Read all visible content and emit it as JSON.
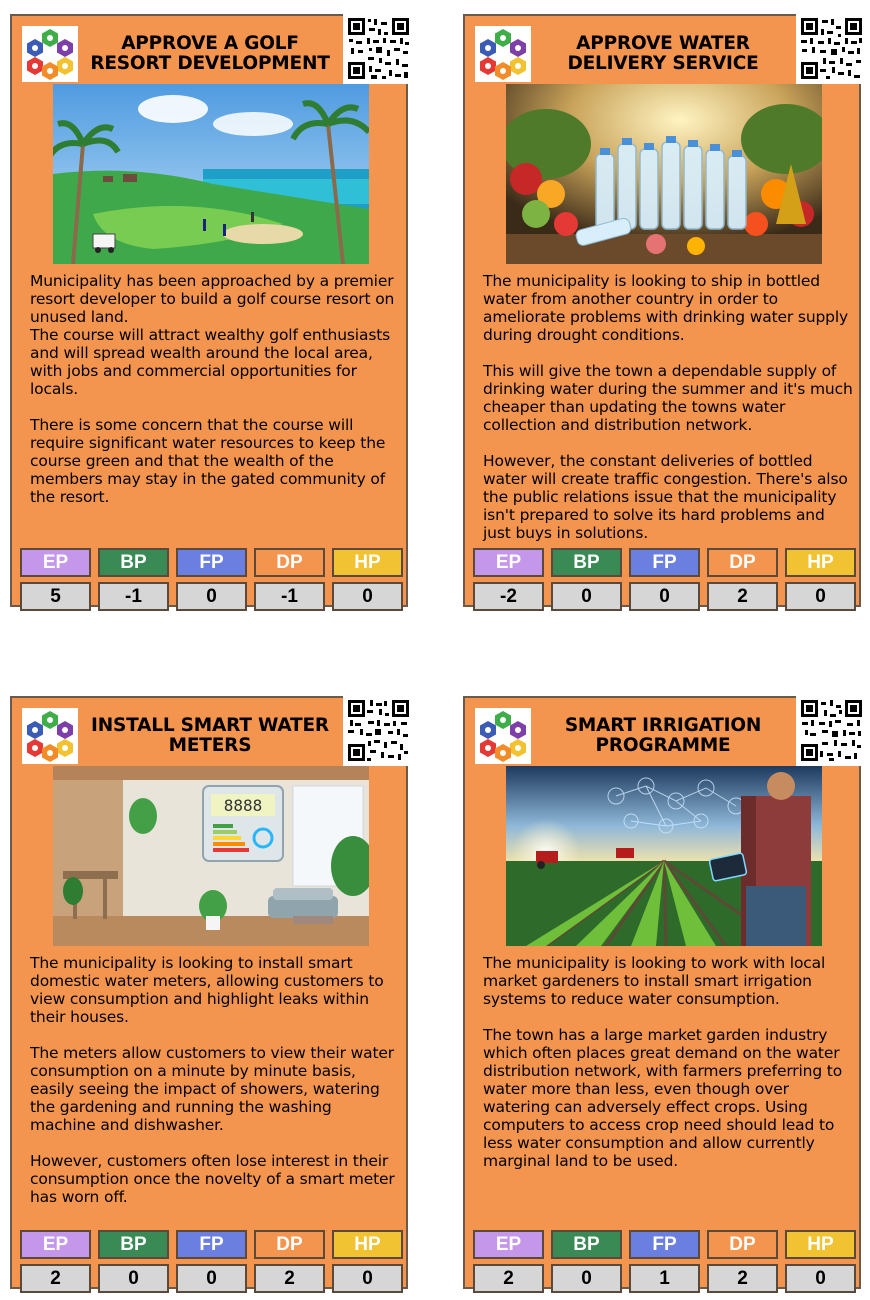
{
  "stat_colors": {
    "EP": "#c497ea",
    "BP": "#3a8a56",
    "FP": "#6a7fe0",
    "DP": "#f4954f",
    "HP": "#f1c232"
  },
  "cards": [
    {
      "title": "APPROVE A GOLF RESORT DEVELOPMENT",
      "image": "golf-resort-photo",
      "paragraphs": [
        "Municipality has been approached by a premier resort developer to build a golf course resort on unused land.\nThe course will attract wealthy golf enthusiasts and will spread wealth around the local area, with jobs and commercial opportunities for locals.",
        "There is some concern that the course will require significant water resources to keep the course green and that the wealth of the members may stay in the gated community of the resort."
      ],
      "stats": [
        {
          "label": "EP",
          "value": "5"
        },
        {
          "label": "BP",
          "value": "-1"
        },
        {
          "label": "FP",
          "value": "0"
        },
        {
          "label": "DP",
          "value": "-1"
        },
        {
          "label": "HP",
          "value": "0"
        }
      ]
    },
    {
      "title": "APPROVE WATER DELIVERY SERVICE",
      "image": "bottled-water-and-fruit-photo",
      "paragraphs": [
        "The municipality is looking to ship in bottled water from another country in order to ameliorate problems with drinking water supply during drought conditions.",
        "This will give the town a dependable supply of drinking water during the summer and it's much cheaper than updating the towns water collection and distribution network.",
        "However, the constant deliveries of bottled water will create traffic congestion. There's also the public relations issue that the municipality isn't prepared to solve its hard problems and just buys in solutions."
      ],
      "stats": [
        {
          "label": "EP",
          "value": "-2"
        },
        {
          "label": "BP",
          "value": "0"
        },
        {
          "label": "FP",
          "value": "0"
        },
        {
          "label": "DP",
          "value": "2"
        },
        {
          "label": "HP",
          "value": "0"
        }
      ]
    },
    {
      "title": "INSTALL SMART WATER METERS",
      "image": "smart-meter-home-photo",
      "paragraphs": [
        "The municipality is looking to install smart domestic water meters, allowing customers to view consumption and highlight leaks within their houses.",
        "The meters allow customers to view their water consumption on a minute by minute basis, easily seeing the impact of showers, watering the gardening and running the washing machine and dishwasher.",
        "However, customers often lose interest in their consumption once the novelty of a smart meter has worn off."
      ],
      "stats": [
        {
          "label": "EP",
          "value": "2"
        },
        {
          "label": "BP",
          "value": "0"
        },
        {
          "label": "FP",
          "value": "0"
        },
        {
          "label": "DP",
          "value": "2"
        },
        {
          "label": "HP",
          "value": "0"
        }
      ]
    },
    {
      "title": "SMART IRRIGATION PROGRAMME",
      "image": "smart-irrigation-field-photo",
      "paragraphs": [
        "The municipality is looking to work with local market gardeners to install smart irrigation systems to reduce water consumption.",
        "The town has a large market garden industry which often places great demand on the water distribution network, with farmers preferring to water more than less, even though over watering can adversely effect crops. Using computers to access crop need should lead to less water consumption and allow currently marginal land to be used."
      ],
      "stats": [
        {
          "label": "EP",
          "value": "2"
        },
        {
          "label": "BP",
          "value": "0"
        },
        {
          "label": "FP",
          "value": "1"
        },
        {
          "label": "DP",
          "value": "2"
        },
        {
          "label": "HP",
          "value": "0"
        }
      ]
    }
  ]
}
